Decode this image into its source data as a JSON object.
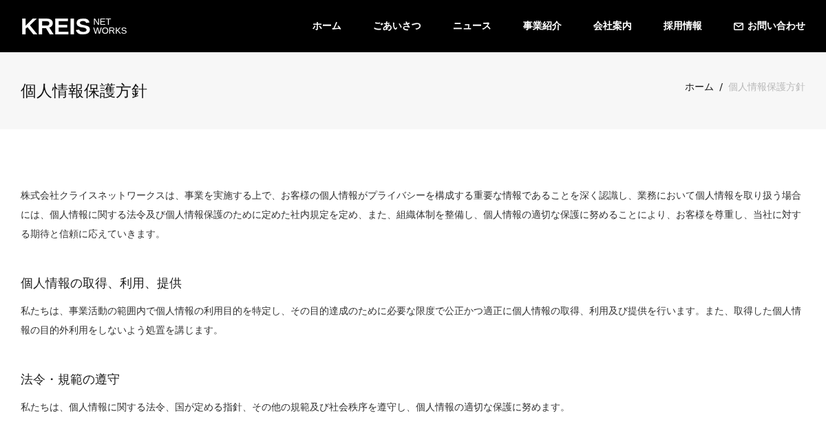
{
  "header": {
    "logo": {
      "main": "KREIS",
      "sub": [
        "NET",
        "WORKS"
      ]
    },
    "nav": [
      {
        "label": "ホーム",
        "kind": "link"
      },
      {
        "label": "ごあいさつ",
        "kind": "link"
      },
      {
        "label": "ニュース",
        "kind": "link"
      },
      {
        "label": "事業紹介",
        "kind": "link"
      },
      {
        "label": "会社案内",
        "kind": "link"
      },
      {
        "label": "採用情報",
        "kind": "link"
      },
      {
        "label": "お問い合わせ",
        "kind": "contact"
      }
    ]
  },
  "page_title": "個人情報保護方針",
  "breadcrumb_separator": "/",
  "breadcrumb": [
    {
      "label": "ホーム",
      "current": false
    },
    {
      "label": "個人情報保護方針",
      "current": true
    }
  ],
  "intro": "株式会社クライスネットワークスは、事業を実施する上で、お客様の個人情報がプライバシーを構成する重要な情報であることを深く認識し、業務において個人情報を取り扱う場合には、個人情報に関する法令及び個人情報保護のために定めた社内規定を定め、また、組織体制を整備し、個人情報の適切な保護に努めることにより、お客様を尊重し、当社に対する期待と信頼に応えていきます。",
  "sections": [
    {
      "heading": "個人情報の取得、利用、提供",
      "body": "私たちは、事業活動の範囲内で個人情報の利用目的を特定し、その目的達成のために必要な限度で公正かつ適正に個人情報の取得、利用及び提供を行います。また、取得した個人情報の目的外利用をしないよう処置を講じます。"
    },
    {
      "heading": "法令・規範の遵守",
      "body": "私たちは、個人情報に関する法令、国が定める指針、その他の規範及び社会秩序を遵守し、個人情報の適切な保護に努めます。"
    }
  ]
}
